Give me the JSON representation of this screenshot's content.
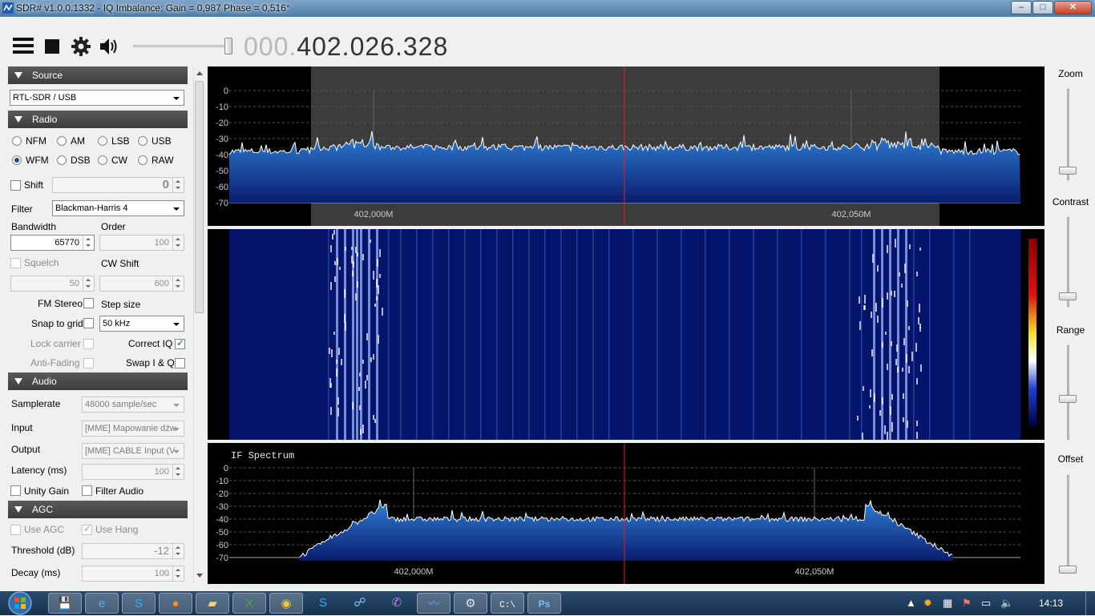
{
  "window": {
    "title": "SDR# v1.0.0.1332 - IQ Imbalance: Gain = 0,987 Phase = 0,516°",
    "minimize": "–",
    "maximize": "□",
    "close": "✕"
  },
  "toolbar": {
    "menu_icon": "hamburger-icon",
    "stop_icon": "stop-icon",
    "settings_icon": "gear-icon",
    "audio_icon": "speaker-icon",
    "volume_level": 1.0,
    "freq_dim": "000.",
    "freq_main": "402.026.328"
  },
  "sections": {
    "source": {
      "header": "Source",
      "device": "RTL-SDR / USB"
    },
    "radio": {
      "header": "Radio",
      "modes": [
        "NFM",
        "AM",
        "LSB",
        "USB",
        "WFM",
        "DSB",
        "CW",
        "RAW"
      ],
      "selected_mode": "WFM",
      "shift_label": "Shift",
      "shift_value": "0",
      "filter_label": "Filter",
      "filter_value": "Blackman-Harris 4",
      "bandwidth_label": "Bandwidth",
      "bandwidth_value": "65770",
      "order_label": "Order",
      "order_value": "100",
      "squelch_label": "Squelch",
      "squelch_value": "50",
      "cwshift_label": "CW Shift",
      "cwshift_value": "600",
      "fmstereo_label": "FM Stereo",
      "stepsize_label": "Step size",
      "snap_label": "Snap to grid",
      "step_value": "50 kHz",
      "lockcarrier_label": "Lock carrier",
      "correctiq_label": "Correct IQ",
      "antifading_label": "Anti-Fading",
      "swapiq_label": "Swap I & Q"
    },
    "audio": {
      "header": "Audio",
      "samplerate_label": "Samplerate",
      "samplerate_value": "48000 sample/sec",
      "input_label": "Input",
      "input_value": "[MME] Mapowanie dźw",
      "output_label": "Output",
      "output_value": "[MME] CABLE Input (V",
      "latency_label": "Latency (ms)",
      "latency_value": "100",
      "unitygain_label": "Unity Gain",
      "filteraudio_label": "Filter Audio"
    },
    "agc": {
      "header": "AGC",
      "useagc_label": "Use AGC",
      "usehang_label": "Use Hang",
      "threshold_label": "Threshold (dB)",
      "threshold_value": "-12",
      "decay_label": "Decay (ms)",
      "decay_value": "100"
    }
  },
  "spectrum": {
    "y_ticks": [
      "0",
      "-10",
      "-20",
      "-30",
      "-40",
      "-50",
      "-60",
      "-70"
    ],
    "x_labels": [
      "402,000M",
      "402,050M"
    ]
  },
  "if_spectrum": {
    "title": "IF Spectrum",
    "y_ticks": [
      "0",
      "-10",
      "-20",
      "-30",
      "-40",
      "-50",
      "-60",
      "-70"
    ],
    "x_labels": [
      "402,000M",
      "402,050M"
    ]
  },
  "right": {
    "zoom_label": "Zoom",
    "contrast_label": "Contrast",
    "range_label": "Range",
    "offset_label": "Offset"
  },
  "taskbar": {
    "start_icon": "windows-start-icon",
    "apps": [
      "save-icon",
      "ie-icon",
      "skype-icon",
      "firefox-icon",
      "folder-icon",
      "excel-icon",
      "chrome-icon",
      "skype-icon",
      "network-icon",
      "viber-icon",
      "sdr-icon",
      "settings-icon",
      "cmd-icon",
      "photoshop-icon"
    ],
    "clock": "14:13"
  }
}
